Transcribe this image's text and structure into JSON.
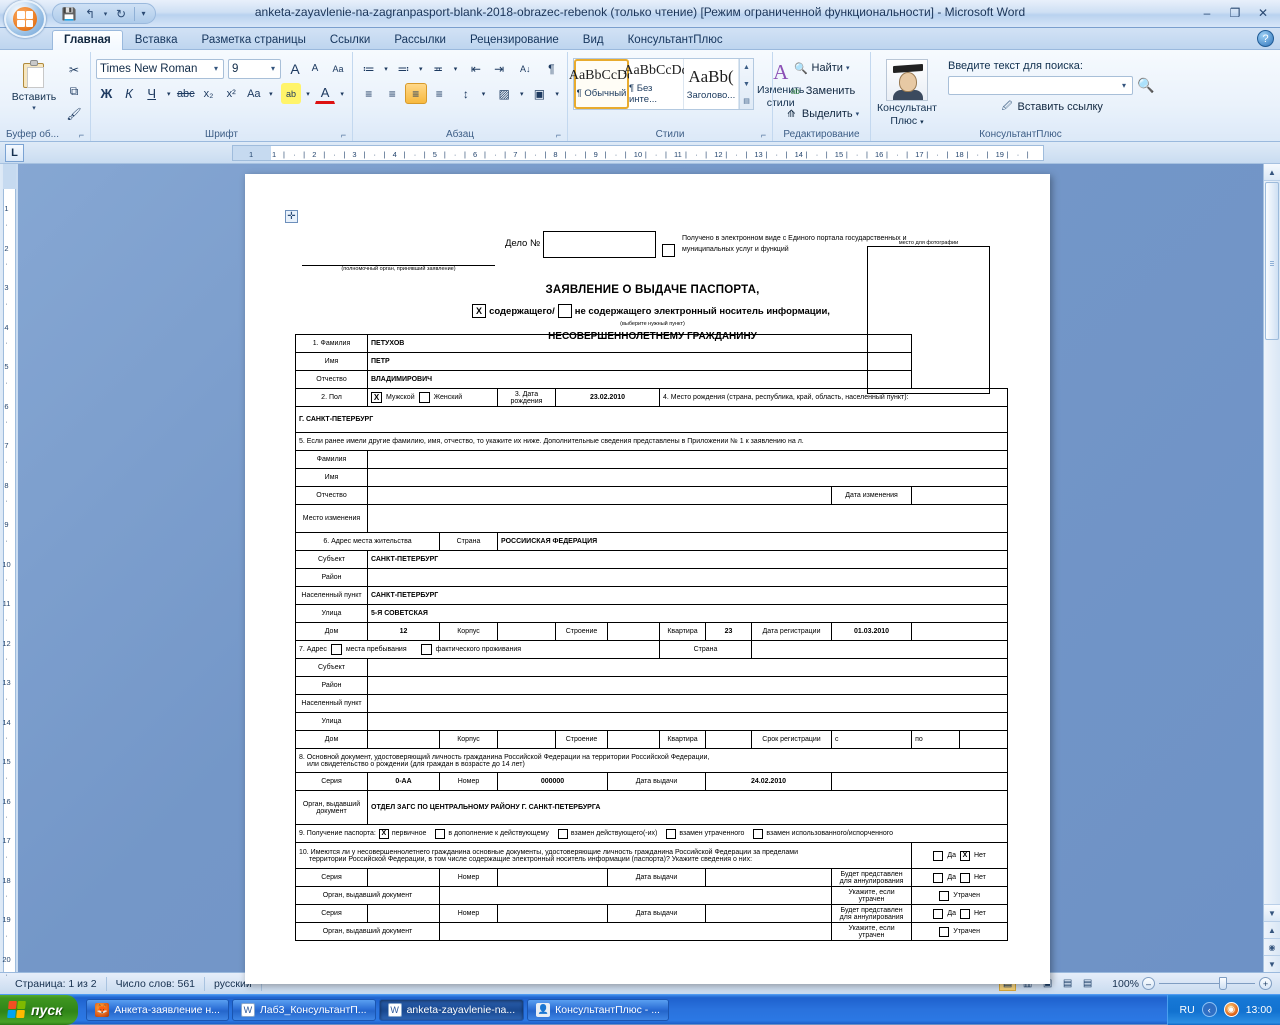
{
  "window": {
    "title": "anketa-zayavlenie-na-zagranpasport-blank-2018-obrazec-rebenok (только чтение) [Режим ограниченной функциональности] - Microsoft Word",
    "minimize": "–",
    "restore": "❐",
    "close": "✕",
    "help": "?"
  },
  "quick_access": {
    "save": "💾",
    "undo": "↰",
    "undo_caret": "▾",
    "redo": "↻",
    "customize": "▾"
  },
  "tabs": [
    {
      "label": "Главная",
      "active": true
    },
    {
      "label": "Вставка",
      "active": false
    },
    {
      "label": "Разметка страницы",
      "active": false
    },
    {
      "label": "Ссылки",
      "active": false
    },
    {
      "label": "Рассылки",
      "active": false
    },
    {
      "label": "Рецензирование",
      "active": false
    },
    {
      "label": "Вид",
      "active": false
    },
    {
      "label": "КонсультантПлюс",
      "active": false
    }
  ],
  "ribbon": {
    "clipboard": {
      "title": "Буфер об...",
      "paste_label": "Вставить",
      "paste_caret": "▾",
      "cut": "✂",
      "copy": "⧉",
      "format_painter": "🖌",
      "launcher": "⌐"
    },
    "font": {
      "title": "Шрифт",
      "font_name": "Times New Roman",
      "font_size": "9",
      "grow": "A",
      "shrink": "A",
      "clear_format": "Aa",
      "bold": "Ж",
      "italic": "К",
      "underline": "Ч",
      "underline_caret": "▾",
      "strike": "abc",
      "subscript": "x₂",
      "superscript": "x²",
      "change_case": "Aa",
      "change_case_caret": "▾",
      "highlight": "ab",
      "highlight_caret": "▾",
      "font_color": "A",
      "font_color_caret": "▾",
      "launcher": "⌐"
    },
    "paragraph": {
      "title": "Абзац",
      "bullets": "≔",
      "numbering": "≕",
      "multilevel": "≖",
      "decrease_indent": "⇤",
      "increase_indent": "⇥",
      "sort": "A↓",
      "show_marks": "¶",
      "align_left": "≡",
      "align_center": "≡",
      "align_right": "≡",
      "align_justify": "≡",
      "line_spacing": "↕",
      "shading": "▨",
      "borders": "▣",
      "caret": "▾",
      "launcher": "⌐"
    },
    "styles": {
      "title": "Стили",
      "items": [
        {
          "preview": "AaBbCcDd",
          "name": "¶ Обычный",
          "selected": true
        },
        {
          "preview": "AaBbCcDd",
          "name": "¶ Без инте...",
          "selected": false
        },
        {
          "preview": "AaBb(",
          "name": "Заголово...",
          "selected": false
        }
      ],
      "scroll_up": "▲",
      "scroll_down": "▼",
      "more": "▤",
      "change_styles_label": "Изменить",
      "change_styles_label2": "стили",
      "change_styles_caret": "▾",
      "launcher": "⌐"
    },
    "editing": {
      "title": "Редактирование",
      "find": "Найти",
      "find_caret": "▾",
      "replace": "Заменить",
      "select": "Выделить",
      "select_caret": "▾"
    },
    "consultant": {
      "title": "КонсультантПлюс",
      "button_line1": "Консультант",
      "button_line2": "Плюс",
      "button_caret": "▾",
      "search_label": "Введите текст для поиска:",
      "search_value": "",
      "search_caret": "▾",
      "search_icon": "search-icon",
      "insert_link": "Вставить ссылку"
    }
  },
  "ruler": {
    "tab_selector": "L",
    "h_ticks": [
      "1",
      "1",
      "2",
      "3",
      "4",
      "5",
      "6",
      "7",
      "8",
      "9",
      "10",
      "11",
      "12",
      "13",
      "14",
      "15",
      "16",
      "17",
      "18",
      "19"
    ],
    "v_ticks": [
      "1",
      "2",
      "3",
      "4",
      "5",
      "6",
      "7",
      "8",
      "9",
      "10",
      "11",
      "12",
      "13",
      "14",
      "15",
      "16",
      "17",
      "18",
      "19",
      "20"
    ]
  },
  "document": {
    "anchor_icon": "move-handle-icon",
    "delo_label": "Дело №",
    "delo_value": "",
    "eportal_text": "Получено в электронном виде с Единого портала государственных и муниципальных услуг и функций",
    "eportal_checked": "",
    "org_caption": "(полномочный орган, принявший заявление)",
    "title1": "ЗАЯВЛЕНИЕ О ВЫДАЧЕ ПАСПОРТА,",
    "title2_cb1": "X",
    "title2_t1": "содержащего/",
    "title2_cb2": "",
    "title2_t2": "не содержащего электронный носитель информации,",
    "title2_sub": "(выберите нужный пункт)",
    "title3": "НЕСОВЕРШЕННОЛЕТНЕМУ ГРАЖДАНИНУ",
    "photo_caption": "место для фотографии",
    "rows": {
      "r1_label": "1. Фамилия",
      "r1_value": "ПЕТУХОВ",
      "r2_label": "Имя",
      "r2_value": "ПЕТР",
      "r3_label": "Отчество",
      "r3_value": "ВЛАДИМИРОВИЧ",
      "r4_label": "2. Пол",
      "r4_male_cb": "X",
      "r4_male": "Мужской",
      "r4_female_cb": "",
      "r4_female": "Женский",
      "r4_birth_label": "3. Дата рождения",
      "r4_birth_value": "23.02.2010",
      "r4_place_label": "4. Место рождения (страна, республика, край, область, населенный пункт):",
      "r5_place_value": "Г. САНКТ-ПЕТЕРБУРГ",
      "r6_text": "5. Если ранее имели другие фамилию, имя, отчество, то укажите их ниже. Дополнительные сведения представлены в Приложении № 1 к заявлению на           л.",
      "r7_label": "Фамилия",
      "r7_value": "",
      "r8_label": "Имя",
      "r8_value": "",
      "r9_label": "Отчество",
      "r9_value": "",
      "r9_date_label": "Дата изменения",
      "r9_date_value": "",
      "r10_label": "Место изменения",
      "r10_value": "",
      "r11_label": "6. Адрес места жительства",
      "r11_country_label": "Страна",
      "r11_country_value": "РОССИИСКАЯ ФЕДЕРАЦИЯ",
      "r12_label": "Субъект",
      "r12_value": "САНКТ-ПЕТЕРБУРГ",
      "r13_label": "Район",
      "r13_value": "",
      "r14_label": "Населенный пункт",
      "r14_value": "САНКТ-ПЕТЕРБУРГ",
      "r15_label": "Улица",
      "r15_value": "5-Я СОВЕТСКАЯ",
      "r16_house_label": "Дом",
      "r16_house_value": "12",
      "r16_korp_label": "Корпус",
      "r16_korp_value": "",
      "r16_stro_label": "Строение",
      "r16_stro_value": "",
      "r16_kvar_label": "Квартира",
      "r16_kvar_value": "23",
      "r16_reg_label": "Дата регистрации",
      "r16_reg_value": "01.03.2010",
      "r17_label": "7. Адрес",
      "r17_cb1": "",
      "r17_t1": "места пребывания",
      "r17_cb2": "",
      "r17_t2": "фактического проживания",
      "r17_country_label": "Страна",
      "r17_country_value": "",
      "r18_label": "Субъект",
      "r18_value": "",
      "r19_label": "Район",
      "r19_value": "",
      "r20_label": "Населенный пункт",
      "r20_value": "",
      "r21_label": "Улица",
      "r21_value": "",
      "r22_house_label": "Дом",
      "r22_house_value": "",
      "r22_korp_label": "Корпус",
      "r22_korp_value": "",
      "r22_stro_label": "Строение",
      "r22_stro_value": "",
      "r22_kvar_label": "Квартира",
      "r22_kvar_value": "",
      "r22_term_label": "Срок регистрации",
      "r22_from_label": "с",
      "r22_from_value": "",
      "r22_to_label": "по",
      "r22_to_value": "",
      "r23_line1": "8. Основной документ, удостоверяющий личность гражданина Российской Федерации на территории Российской Федерации,",
      "r23_line2": "или свидетельство о рождении (для граждан в возрасте до 14 лет)",
      "r24_ser_label": "Серия",
      "r24_ser_value": "0-АА",
      "r24_num_label": "Номер",
      "r24_num_value": "000000",
      "r24_date_label": "Дата выдачи",
      "r24_date_value": "24.02.2010",
      "r25_label": "Орган, выдавший документ",
      "r25_value": "ОТДЕЛ ЗАГС ПО ЦЕНТРАЛЬНОМУ РАЙОНУ Г. САНКТ-ПЕТЕРБУРГА",
      "r26_label": "9. Получение паспорта:",
      "r26_cb1": "X",
      "r26_t1": "первичное",
      "r26_cb2": "",
      "r26_t2": "в дополнение к действующему",
      "r26_cb3": "",
      "r26_t3": "взамен действующего(-их)",
      "r26_cb4": "",
      "r26_t4": "взамен утраченного",
      "r26_cb5": "",
      "r26_t5": "взамен использованного/испорченного",
      "r27_line1": "10. Имеются ли у несовершеннолетнего гражданина основные документы, удостоверяющие личность гражданина Российской Федерации за пределами",
      "r27_line2": "территории Российской Федерации, в том числе содержащие электронный носитель информации (паспорта)? Укажите сведения о них:",
      "r27_yes_cb": "",
      "r27_yes": "Да",
      "r27_no_cb": "X",
      "r27_no": "Нет",
      "r28_ser_label": "Серия",
      "r28_ser_value": "",
      "r28_num_label": "Номер",
      "r28_num_value": "",
      "r28_date_label": "Дата выдачи",
      "r28_date_value": "",
      "r28_annul_label": "Будет представлен для аннулирования",
      "r28_yes_cb": "",
      "r28_yes": "Да",
      "r28_no_cb": "",
      "r28_no": "Нет",
      "r29_label": "Орган, выдавший документ",
      "r29_value": "",
      "r29_lost_label": "Укажите, если утрачен",
      "r29_lost_cb": "",
      "r29_lost": "Утрачен",
      "r30_ser_label": "Серия",
      "r30_ser_value": "",
      "r30_num_label": "Номер",
      "r30_num_value": "",
      "r30_date_label": "Дата выдачи",
      "r30_date_value": "",
      "r30_annul_label": "Будет представлен для аннулирования",
      "r30_yes_cb": "",
      "r30_yes": "Да",
      "r30_no_cb": "",
      "r30_no": "Нет",
      "r31_label": "Орган, выдавший документ",
      "r31_value": "",
      "r31_lost_label": "Укажите, если утрачен",
      "r31_lost_cb": "",
      "r31_lost": "Утрачен"
    }
  },
  "statusbar": {
    "page": "Страница: 1 из 2",
    "words": "Число слов: 561",
    "language": "русский",
    "view_print": "▤",
    "view_fullscreen": "▥",
    "view_web": "▣",
    "view_outline": "▤",
    "view_draft": "▤",
    "zoom": "100%",
    "zoom_out": "–",
    "zoom_in": "+"
  },
  "taskbar": {
    "start": "пуск",
    "buttons": [
      {
        "label": "Анкета-заявление н...",
        "icon": "firefox-icon",
        "active": false
      },
      {
        "label": "Лаб3_КонсультантП...",
        "icon": "word-icon",
        "active": false
      },
      {
        "label": "anketa-zayavlenie-na...",
        "icon": "word-icon",
        "active": true
      },
      {
        "label": "КонсультантПлюс - ...",
        "icon": "consultant-icon",
        "active": false
      }
    ],
    "language": "RU",
    "clock": "13:00"
  }
}
